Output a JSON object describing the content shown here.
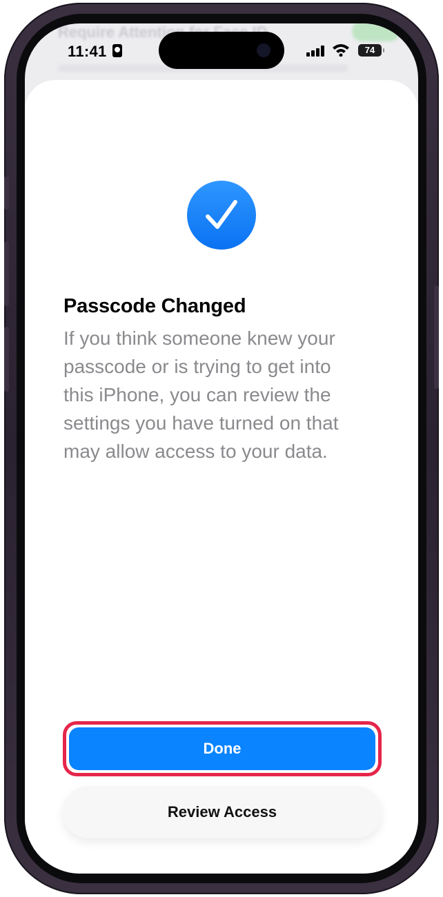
{
  "status_bar": {
    "time": "11:41",
    "battery": "74",
    "icons": [
      "contact-card-icon",
      "signal-icon",
      "wifi-icon",
      "battery-icon"
    ]
  },
  "background": {
    "blurred_title": "Require Attention for Face ID"
  },
  "sheet": {
    "icon": "checkmark-circle-icon",
    "title": "Passcode Changed",
    "body": "If you think someone knew your\npasscode or is trying to get into\nthis iPhone, you can review the\nsettings you have turned on that\nmay allow access to your data.",
    "primary_button": "Done",
    "secondary_button": "Review Access"
  },
  "colors": {
    "accent": "#0a84ff",
    "highlight": "#e5264a",
    "body_text": "#8a8a8e"
  }
}
